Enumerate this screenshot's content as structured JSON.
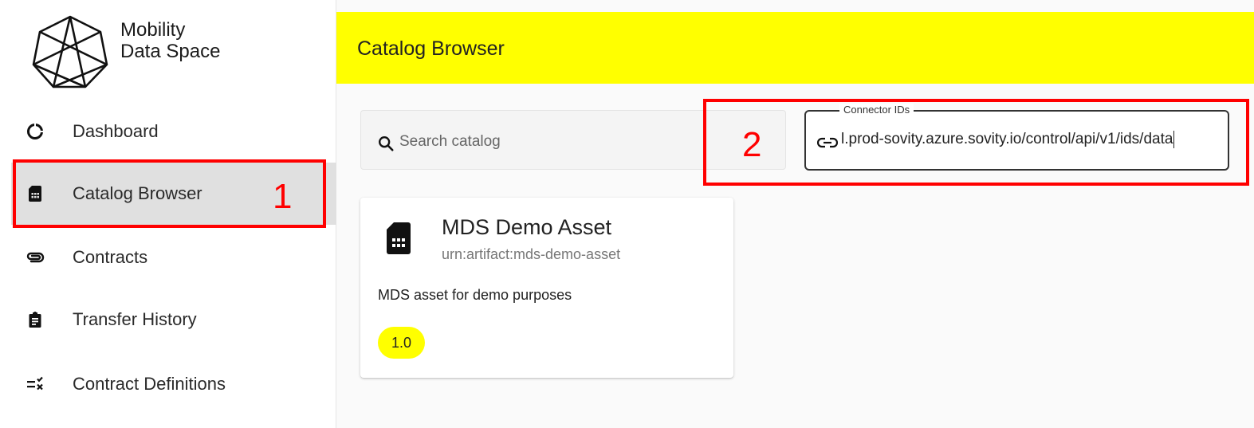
{
  "brand": {
    "line1": "Mobility",
    "line2": "Data Space"
  },
  "sidebar": {
    "items": [
      {
        "label": "Dashboard",
        "icon": "donut-chart-icon",
        "active": false
      },
      {
        "label": "Catalog Browser",
        "icon": "sim-card-icon",
        "active": true
      },
      {
        "label": "Contracts",
        "icon": "paperclip-icon",
        "active": false
      },
      {
        "label": "Transfer History",
        "icon": "clipboard-icon",
        "active": false
      },
      {
        "label": "Contract Definitions",
        "icon": "rule-icon",
        "active": false
      }
    ]
  },
  "topbar": {
    "title": "Catalog Browser"
  },
  "search": {
    "placeholder": "Search catalog",
    "value": ""
  },
  "connector": {
    "legend": "Connector IDs",
    "value": "l.prod-sovity.azure.sovity.io/control/api/v1/ids/data"
  },
  "asset": {
    "title": "MDS Demo Asset",
    "id": "urn:artifact:mds-demo-asset",
    "description": "MDS asset for demo purposes",
    "version": "1.0"
  },
  "annotations": {
    "one": "1",
    "two": "2"
  },
  "colors": {
    "accent": "#ffff00",
    "active_nav": "#e0e0e0",
    "callout": "#ff0000"
  }
}
